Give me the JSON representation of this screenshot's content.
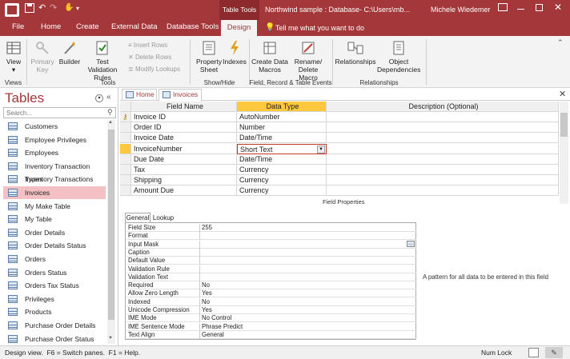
{
  "titlebar": {
    "context_tab": "Table Tools",
    "title": "Northwind sample : Database- C:\\Users\\mb...",
    "user": "Michele Wiedemer",
    "help": "?"
  },
  "tabs": [
    "File",
    "Home",
    "Create",
    "External Data",
    "Database Tools",
    "Design"
  ],
  "tell_me": "Tell me what you want to do",
  "ribbon": {
    "view": "View",
    "primary_key": "Primary Key",
    "builder": "Builder",
    "test_validation": "Test Validation Rules",
    "insert_rows": "Insert Rows",
    "delete_rows": "Delete Rows",
    "modify_lookups": "Modify Lookups",
    "property_sheet": "Property Sheet",
    "indexes": "Indexes",
    "create_data_macros": "Create Data Macros",
    "rename_delete_macro": "Rename/ Delete Macro",
    "relationships": "Relationships",
    "object_dependencies": "Object Dependencies",
    "groups": [
      "Views",
      "Tools",
      "Show/Hide",
      "Field, Record & Table Events",
      "Relationships"
    ]
  },
  "nav": {
    "header": "Tables",
    "search_placeholder": "Search...",
    "items": [
      "Customers",
      "Employee Privileges",
      "Employees",
      "Inventory Transaction Types",
      "Inventory Transactions",
      "Invoices",
      "My Make Table",
      "My Table",
      "Order Details",
      "Order Details Status",
      "Orders",
      "Orders Status",
      "Orders Tax Status",
      "Privileges",
      "Products",
      "Purchase Order Details",
      "Purchase Order Status"
    ],
    "selected_index": 5
  },
  "doc_tabs": [
    "Home",
    "Invoices"
  ],
  "design": {
    "headers": [
      "Field Name",
      "Data Type",
      "Description (Optional)"
    ],
    "rows": [
      {
        "name": "Invoice ID",
        "type": "AutoNumber"
      },
      {
        "name": "Order ID",
        "type": "Number"
      },
      {
        "name": "Invoice Date",
        "type": "Date/Time"
      },
      {
        "name": "InvoiceNumber",
        "type": "Short Text"
      },
      {
        "name": "Due Date",
        "type": "Date/Time"
      },
      {
        "name": "Tax",
        "type": "Currency"
      },
      {
        "name": "Shipping",
        "type": "Currency"
      },
      {
        "name": "Amount Due",
        "type": "Currency"
      }
    ]
  },
  "field_properties": {
    "title": "Field Properties",
    "tabs": [
      "General",
      "Lookup"
    ],
    "rows": [
      {
        "label": "Field Size",
        "value": "255"
      },
      {
        "label": "Format",
        "value": ""
      },
      {
        "label": "Input Mask",
        "value": ""
      },
      {
        "label": "Caption",
        "value": ""
      },
      {
        "label": "Default Value",
        "value": ""
      },
      {
        "label": "Validation Rule",
        "value": ""
      },
      {
        "label": "Validation Text",
        "value": ""
      },
      {
        "label": "Required",
        "value": "No"
      },
      {
        "label": "Allow Zero Length",
        "value": "Yes"
      },
      {
        "label": "Indexed",
        "value": "No"
      },
      {
        "label": "Unicode Compression",
        "value": "Yes"
      },
      {
        "label": "IME Mode",
        "value": "No Control"
      },
      {
        "label": "IME Sentence Mode",
        "value": "Phrase Predict"
      },
      {
        "label": "Text Align",
        "value": "General"
      }
    ],
    "help_text": "A pattern for all data to be entered in this field"
  },
  "status": {
    "left": "Design view.  F6 = Switch panes.  F1 = Help.",
    "num_lock": "Num Lock"
  }
}
